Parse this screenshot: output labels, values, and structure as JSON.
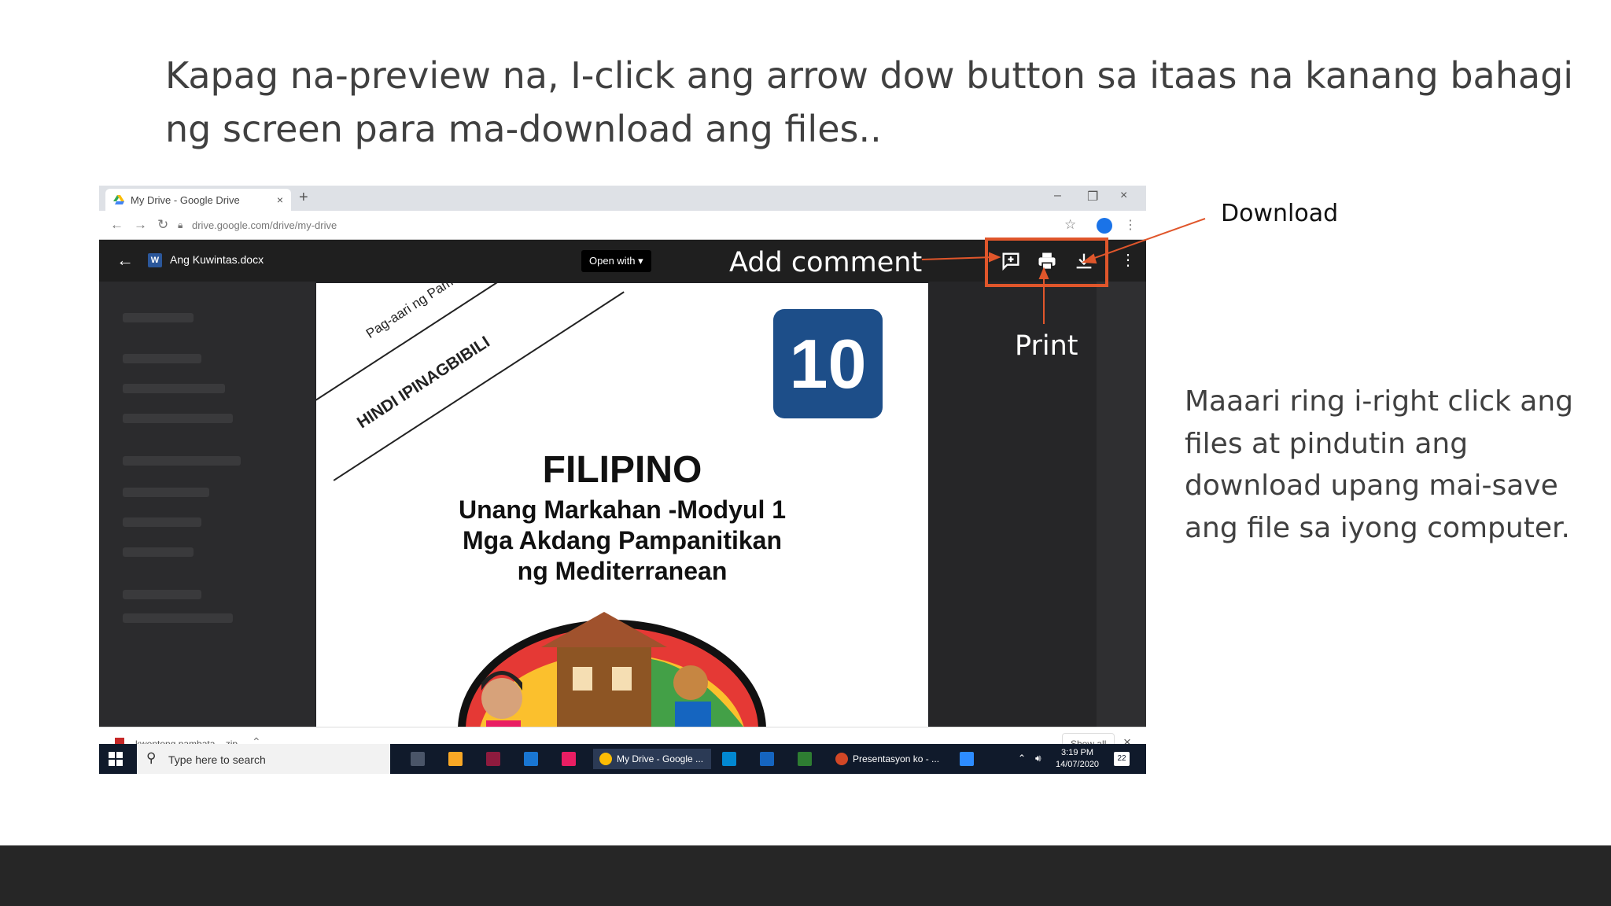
{
  "slide": {
    "title_line1": "Kapag na-preview na, I-click ang arrow dow button sa itaas na kanang bahagi",
    "title_line2": "ng screen para  ma-download ang files..",
    "side_note": [
      "Maaari ring i-right click ang",
      "files at pindutin ang",
      "download upang mai-save",
      "ang file sa iyong computer."
    ]
  },
  "callouts": {
    "add_comment": "Add comment",
    "print": "Print",
    "download": "Download",
    "accent_color": "#e0562b"
  },
  "browser": {
    "tab_title": "My Drive - Google Drive",
    "tab_close": "×",
    "new_tab": "+",
    "url": "drive.google.com/drive/my-drive",
    "minimize": "–",
    "restore": "❐",
    "close": "×"
  },
  "viewer": {
    "doc_name": "Ang Kuwintas.docx",
    "open_with": "Open with ▾",
    "icons": [
      "add-comment-icon",
      "print-icon",
      "download-icon",
      "more-icon"
    ]
  },
  "document": {
    "banner_line1": "Pag-aari ng Pamahalaan",
    "banner_line2": "HINDI IPINAGBIBILI",
    "grade": "10",
    "subject": "FILIPINO",
    "line1": "Unang Markahan -Modyul 1",
    "line2": "Mga Akdang Pampanitikan",
    "line3": "ng Mediterranean"
  },
  "downloads": {
    "file": "kwentong pambata....zip",
    "show_all": "Show all",
    "close": "×"
  },
  "taskbar": {
    "search_placeholder": "Type here to search",
    "chrome_app": "My Drive - Google ...",
    "ppt_app": "Presentasyon ko - ...",
    "time": "3:19 PM",
    "date": "14/07/2020",
    "notifications": "22"
  }
}
